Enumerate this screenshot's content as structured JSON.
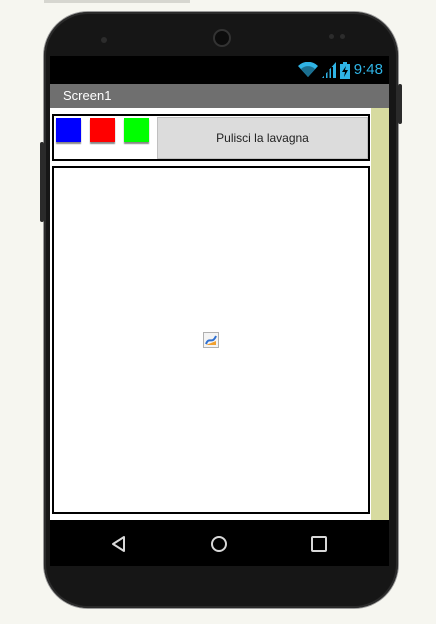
{
  "status_bar": {
    "time": "9:48",
    "wifi_icon": "wifi-icon",
    "signal_icon": "signal-icon",
    "battery_icon": "battery-charging-icon",
    "accent_color": "#2fb4e6"
  },
  "title_bar": {
    "title": "Screen1",
    "background_color": "#6f6f6f"
  },
  "toolbar": {
    "color_buttons": [
      {
        "name": "blue",
        "color": "#0000ff"
      },
      {
        "name": "red",
        "color": "#ff0000"
      },
      {
        "name": "green",
        "color": "#00ff00"
      }
    ],
    "clear_button_label": "Pulisci la lavagna"
  },
  "canvas": {
    "background_color": "#ffffff",
    "placeholder_icon": "broken-image-icon"
  },
  "nav_bar": {
    "back_icon": "back-triangle-icon",
    "home_icon": "home-circle-icon",
    "recents_icon": "recents-square-icon"
  }
}
